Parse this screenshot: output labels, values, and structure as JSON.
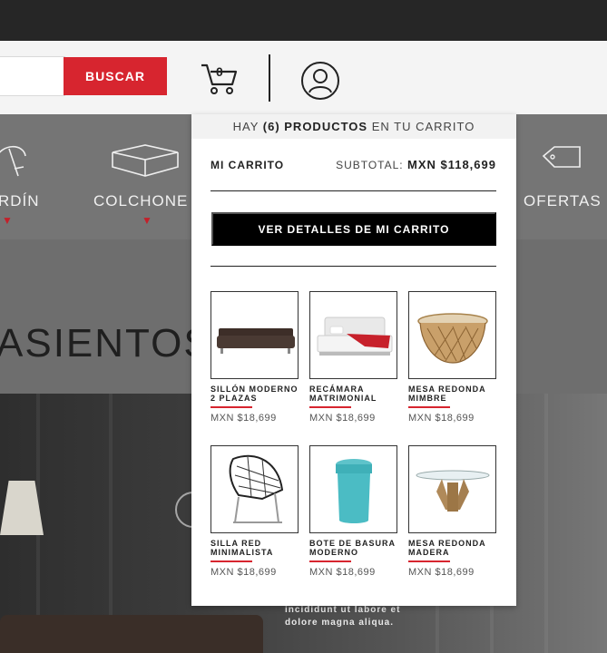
{
  "header": {
    "search_button": "BUSCAR",
    "cart_count": "0"
  },
  "categories": [
    {
      "label": "RDÍN"
    },
    {
      "label": "COLCHONE"
    },
    {
      "label": "OFERTAS"
    }
  ],
  "hero": {
    "title": "ASIENTOS"
  },
  "photo": {
    "caption_line1": "incididunt ut labore et",
    "caption_line2": "dolore magna aliqua."
  },
  "cart": {
    "header_pre": "HAY",
    "header_count": "(6) PRODUCTOS",
    "header_post": "EN TU CARRITO",
    "title": "MI CARRITO",
    "subtotal_label": "SUBTOTAL:",
    "subtotal_value": "MXN $118,699",
    "details_button": "VER DETALLES DE MI CARRITO",
    "products": [
      {
        "name": "SILLÓN MODERNO 2 PLAZAS",
        "price": "MXN $18,699",
        "icon": "sofa"
      },
      {
        "name": "RECÁMARA MATRIMONIAL",
        "price": "MXN $18,699",
        "icon": "bed"
      },
      {
        "name": "MESA REDONDA MIMBRE",
        "price": "MXN $18,699",
        "icon": "wicker-table"
      },
      {
        "name": "SILLA RED MINIMALISTA",
        "price": "MXN $18,699",
        "icon": "wire-chair"
      },
      {
        "name": "BOTE DE BASURA MODERNO",
        "price": "MXN $18,699",
        "icon": "trash-bin"
      },
      {
        "name": "MESA REDONDA MADERA",
        "price": "MXN $18,699",
        "icon": "glass-table"
      }
    ]
  },
  "colors": {
    "accent": "#d7252f",
    "dark": "#000000"
  }
}
